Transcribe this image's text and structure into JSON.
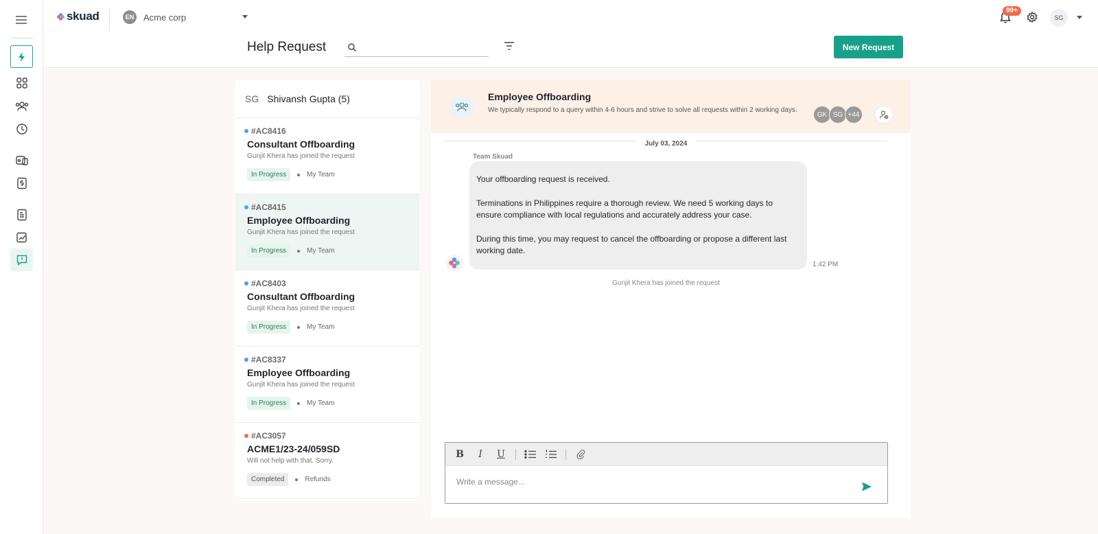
{
  "topbar": {
    "brand": "skuad",
    "org_initials": "EN",
    "org_name": "Acme corp",
    "notification_count": "99+",
    "user_initials": "SG"
  },
  "header": {
    "title": "Help Request",
    "search_placeholder": "",
    "new_request_label": "New Request"
  },
  "list": {
    "owner_initials": "SG",
    "owner_name": "Shivansh Gupta (5)",
    "items": [
      {
        "id": "#AC8416",
        "title": "Consultant Offboarding",
        "subtitle": "Gunjit Khera has joined the request",
        "status": "In Progress",
        "team": "My Team",
        "dot": "#4aa3e8"
      },
      {
        "id": "#AC8415",
        "title": "Employee Offboarding",
        "subtitle": "Gunjit Khera has joined the request",
        "status": "In Progress",
        "team": "My Team",
        "dot": "#4aa3e8"
      },
      {
        "id": "#AC8403",
        "title": "Consultant Offboarding",
        "subtitle": "Gunjit Khera has joined the request",
        "status": "In Progress",
        "team": "My Team",
        "dot": "#4aa3e8"
      },
      {
        "id": "#AC8337",
        "title": "Employee Offboarding",
        "subtitle": "Gunjit Khera has joined the request",
        "status": "In Progress",
        "team": "My Team",
        "dot": "#4aa3e8"
      },
      {
        "id": "#AC3057",
        "title": "ACME1/23-24/059SD",
        "subtitle": "Will not help with that. Sorry.",
        "status": "Completed",
        "team": "Refunds",
        "dot": "#f06a4d"
      }
    ]
  },
  "chat": {
    "title": "Employee Offboarding",
    "description": "We typically respond to a query within 4-6 hours and strive to solve all requests within 2 working days.",
    "members": [
      "GK",
      "SG",
      "+44"
    ],
    "date": "July 03, 2024",
    "sender": "Team Skuad",
    "message": [
      "Your offboarding request is received.",
      "Terminations in Philippines require a thorough review. We need 5 working days to ensure compliance with local regulations and accurately address your case.",
      "During this time, you may request to cancel the offboarding or propose a different last working date."
    ],
    "time": "1:42 PM",
    "system_message": "Gunjit Khera has joined the request",
    "composer_placeholder": "Write a message..."
  },
  "colors": {
    "accent": "#17a18a",
    "notification": "#f06a4d",
    "chat_header_bg": "#fdf0e7"
  }
}
